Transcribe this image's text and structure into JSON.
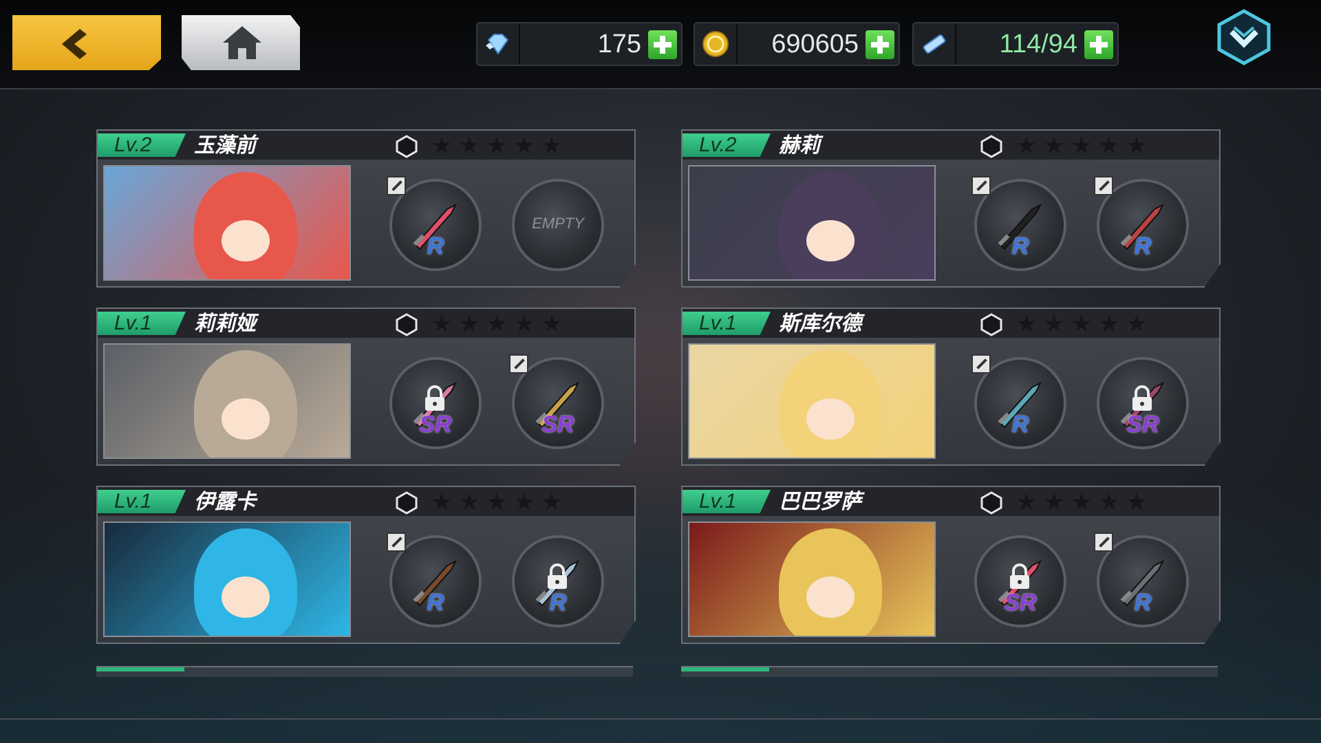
{
  "topbar": {
    "resources": [
      {
        "name": "diamonds",
        "icon": "diamond-icon",
        "value": "175"
      },
      {
        "name": "gold",
        "icon": "gold-coin-icon",
        "value": "690605"
      },
      {
        "name": "stamina",
        "icon": "stamina-ticket-icon",
        "value": "114/94"
      }
    ]
  },
  "colors": {
    "accent_yellow": "#f6c440",
    "level_green": "#2fb67c",
    "plus_green": "#4cc83f",
    "rarity_r": "#3e74d6",
    "rarity_sr": "#8a3fd0"
  },
  "characters": [
    {
      "level": "Lv.2",
      "name": "玉藻前",
      "slots": [
        {
          "rarity": "R",
          "locked": false,
          "edit": true
        },
        {
          "empty_text": "EMPTY"
        }
      ]
    },
    {
      "level": "Lv.2",
      "name": "赫莉",
      "slots": [
        {
          "rarity": "R",
          "locked": false,
          "edit": true
        },
        {
          "rarity": "R",
          "locked": false,
          "edit": true
        }
      ]
    },
    {
      "level": "Lv.1",
      "name": "莉莉娅",
      "slots": [
        {
          "rarity": "SR",
          "locked": true,
          "edit": false
        },
        {
          "rarity": "SR",
          "locked": false,
          "edit": true
        }
      ]
    },
    {
      "level": "Lv.1",
      "name": "斯库尔德",
      "slots": [
        {
          "rarity": "R",
          "locked": false,
          "edit": true
        },
        {
          "rarity": "SR",
          "locked": true,
          "edit": false
        }
      ]
    },
    {
      "level": "Lv.1",
      "name": "伊露卡",
      "slots": [
        {
          "rarity": "R",
          "locked": false,
          "edit": true
        },
        {
          "rarity": "R",
          "locked": true,
          "edit": false
        }
      ]
    },
    {
      "level": "Lv.1",
      "name": "巴巴罗萨",
      "slots": [
        {
          "rarity": "SR",
          "locked": true,
          "edit": false
        },
        {
          "rarity": "R",
          "locked": false,
          "edit": true
        }
      ]
    }
  ]
}
